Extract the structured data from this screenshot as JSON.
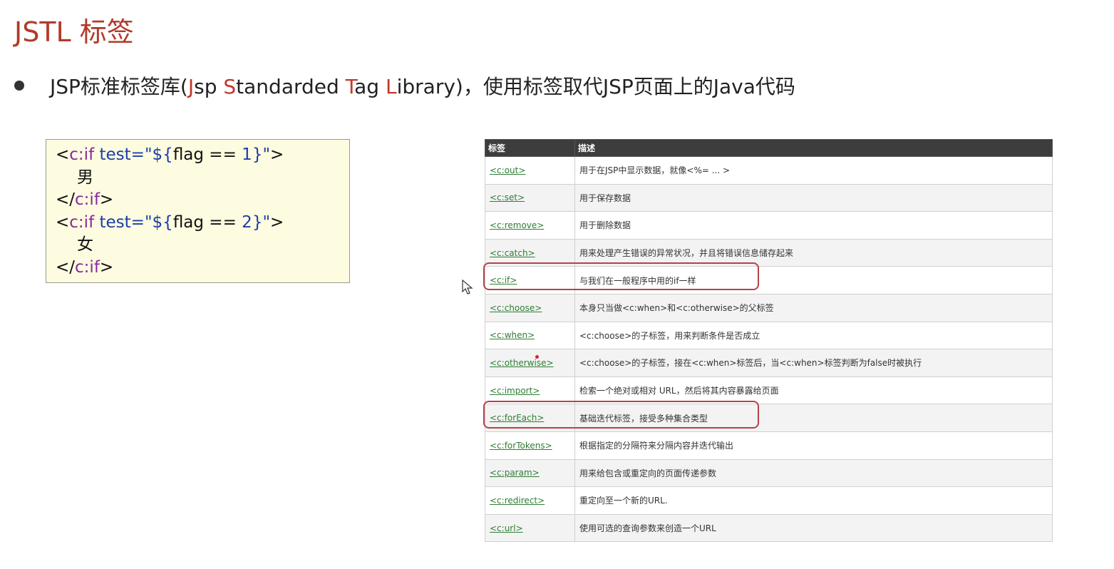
{
  "title": "JSTL 标签",
  "bullet": {
    "prefix": "JSP标准标签库(",
    "j": "J",
    "sp": "sp ",
    "s": "S",
    "tandard": "tandarded ",
    "t": "T",
    "ag": "ag ",
    "l": "L",
    "ibrary": "ibrary)",
    "suffix": "，使用标签取代JSP页面上的Java代码"
  },
  "code": {
    "l1_open": "<",
    "l1_tag": "c:if",
    "l1_attr": " test=",
    "l1_q1": "\"",
    "l1_expr_a": "${",
    "l1_expr_b": "flag == ",
    "l1_expr_c": "1",
    "l1_expr_d": "}",
    "l1_q2": "\"",
    "l1_close": ">",
    "l2": "男",
    "l3_open": "</",
    "l3_tag": "c:if",
    "l3_close": ">",
    "l4_open": "<",
    "l4_tag": "c:if",
    "l4_attr": " test=",
    "l4_q1": "\"",
    "l4_expr_a": "${",
    "l4_expr_b": "flag == ",
    "l4_expr_c": "2",
    "l4_expr_d": "}",
    "l4_q2": "\"",
    "l4_close": ">",
    "l5": "女",
    "l6_open": "</",
    "l6_tag": "c:if",
    "l6_close": ">"
  },
  "table": {
    "headers": [
      "标签",
      "描述"
    ],
    "rows": [
      {
        "tag": "<c:out>",
        "desc": "用于在JSP中显示数据，就像<%= ... >"
      },
      {
        "tag": "<c:set>",
        "desc": "用于保存数据"
      },
      {
        "tag": "<c:remove>",
        "desc": "用于删除数据"
      },
      {
        "tag": "<c:catch>",
        "desc": "用来处理产生错误的异常状况，并且将错误信息储存起来"
      },
      {
        "tag": "<c:if>",
        "desc": "与我们在一般程序中用的if一样"
      },
      {
        "tag": "<c:choose>",
        "desc": "本身只当做<c:when>和<c:otherwise>的父标签"
      },
      {
        "tag": "<c:when>",
        "desc": "<c:choose>的子标签，用来判断条件是否成立"
      },
      {
        "tag": "<c:otherwise>",
        "desc": "<c:choose>的子标签，接在<c:when>标签后，当<c:when>标签判断为false时被执行"
      },
      {
        "tag": "<c:import>",
        "desc": "检索一个绝对或相对 URL，然后将其内容暴露给页面"
      },
      {
        "tag": "<c:forEach>",
        "desc": "基础迭代标签，接受多种集合类型"
      },
      {
        "tag": "<c:forTokens>",
        "desc": "根据指定的分隔符来分隔内容并迭代输出"
      },
      {
        "tag": "<c:param>",
        "desc": "用来给包含或重定向的页面传递参数"
      },
      {
        "tag": "<c:redirect>",
        "desc": "重定向至一个新的URL."
      },
      {
        "tag": "<c:url>",
        "desc": "使用可选的查询参数来创造一个URL"
      }
    ]
  },
  "colors": {
    "title": "#b23a2a",
    "highlight_border": "#b5424a",
    "tag_link": "#2e7d32",
    "header_bg": "#3d3d3d",
    "code_bg": "#fdfbe0"
  },
  "icons": [
    "mouse-cursor-icon"
  ]
}
